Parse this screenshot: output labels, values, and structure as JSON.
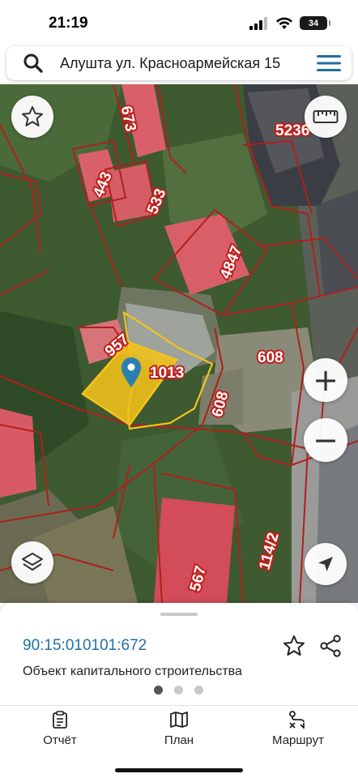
{
  "status": {
    "time": "21:19",
    "battery": "34"
  },
  "search": {
    "text": "Алушта ул. Красноармейская 15"
  },
  "map": {
    "parcel_labels": [
      "673",
      "5236",
      "443",
      "533",
      "4847",
      "957",
      "1013",
      "608",
      "608",
      "114/2",
      "567"
    ],
    "zoom_in_symbol": "+",
    "zoom_out_symbol": "−"
  },
  "sheet": {
    "cadastral_number": "90:15:010101:672",
    "object_type": "Объект капитального строительства"
  },
  "tabs": [
    {
      "label": "Отчёт",
      "icon": "report-icon"
    },
    {
      "label": "План",
      "icon": "map-plan-icon"
    },
    {
      "label": "Маршрут",
      "icon": "route-icon"
    }
  ],
  "colors": {
    "accent": "#1f6f9e",
    "parcel_border": "#b0201c",
    "selected_parcel": "#f2c21a",
    "link_blue": "#2271a8"
  }
}
